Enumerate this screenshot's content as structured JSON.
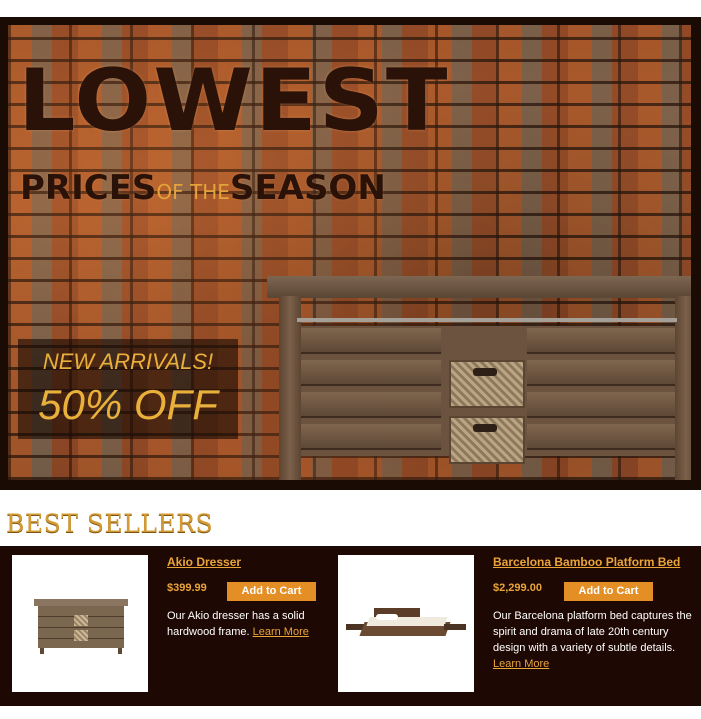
{
  "hero": {
    "headline": "LOWEST",
    "subheadline_left": "PRICES",
    "subheadline_mid": "OF THE",
    "subheadline_right": "SEASON",
    "promo_line1": "NEW ARRIVALS!",
    "promo_line2": "50% OFF"
  },
  "best_sellers": {
    "title": "BEST SELLERS",
    "products": [
      {
        "name": "Akio Dresser",
        "price": "$399.99",
        "cart_label": "Add to Cart",
        "description": "Our Akio dresser has a solid hardwood frame.",
        "learn_more": "Learn More"
      },
      {
        "name": "Barcelona Bamboo Platform Bed",
        "price": "$2,299.00",
        "cart_label": "Add to Cart",
        "description": "Our Barcelona platform bed captures the spirit and drama of late 20th century design with a variety of subtle details.",
        "learn_more": "Learn More"
      }
    ]
  },
  "colors": {
    "accent": "#e9a43a",
    "button": "#e38f26",
    "panel": "#1e0803",
    "frame": "#1a0b04"
  }
}
